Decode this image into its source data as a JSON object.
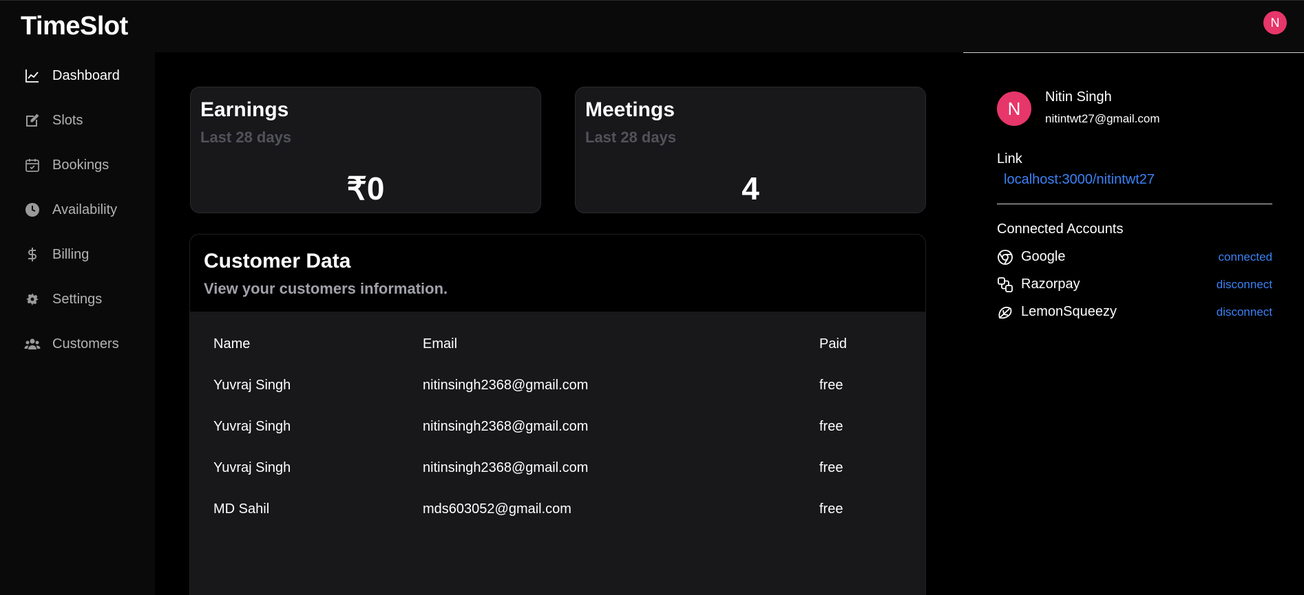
{
  "app": {
    "title": "TimeSlot",
    "avatar_initial": "N"
  },
  "sidebar": {
    "items": [
      {
        "label": "Dashboard",
        "icon": "chart-line-icon",
        "active": true
      },
      {
        "label": "Slots",
        "icon": "edit-icon"
      },
      {
        "label": "Bookings",
        "icon": "calendar-check-icon"
      },
      {
        "label": "Availability",
        "icon": "clock-icon"
      },
      {
        "label": "Billing",
        "icon": "dollar-icon"
      },
      {
        "label": "Settings",
        "icon": "gear-icon"
      },
      {
        "label": "Customers",
        "icon": "users-icon"
      }
    ]
  },
  "stats": {
    "earnings": {
      "title": "Earnings",
      "subtitle": "Last 28 days",
      "value": "₹0"
    },
    "meetings": {
      "title": "Meetings",
      "subtitle": "Last 28 days",
      "value": "4"
    }
  },
  "customers": {
    "title": "Customer Data",
    "subtitle": "View your customers information.",
    "columns": [
      "Name",
      "Email",
      "Paid"
    ],
    "rows": [
      [
        "Yuvraj Singh",
        "nitinsingh2368@gmail.com",
        "free"
      ],
      [
        "Yuvraj Singh",
        "nitinsingh2368@gmail.com",
        "free"
      ],
      [
        "Yuvraj Singh",
        "nitinsingh2368@gmail.com",
        "free"
      ],
      [
        "MD Sahil",
        "mds603052@gmail.com",
        "free"
      ]
    ]
  },
  "profile": {
    "initial": "N",
    "name": "Nitin Singh",
    "email": "nitintwt27@gmail.com",
    "link_label": "Link",
    "link": "localhost:3000/nitintwt27",
    "accounts_title": "Connected Accounts",
    "accounts": [
      {
        "name": "Google",
        "status": "connected",
        "icon": "chrome-icon"
      },
      {
        "name": "Razorpay",
        "status": "disconnect",
        "icon": "razorpay-icon"
      },
      {
        "name": "LemonSqueezy",
        "status": "disconnect",
        "icon": "lemon-icon"
      }
    ]
  },
  "colors": {
    "accent": "#3b82f6",
    "avatar": "#e7366a",
    "card": "#18181b"
  }
}
